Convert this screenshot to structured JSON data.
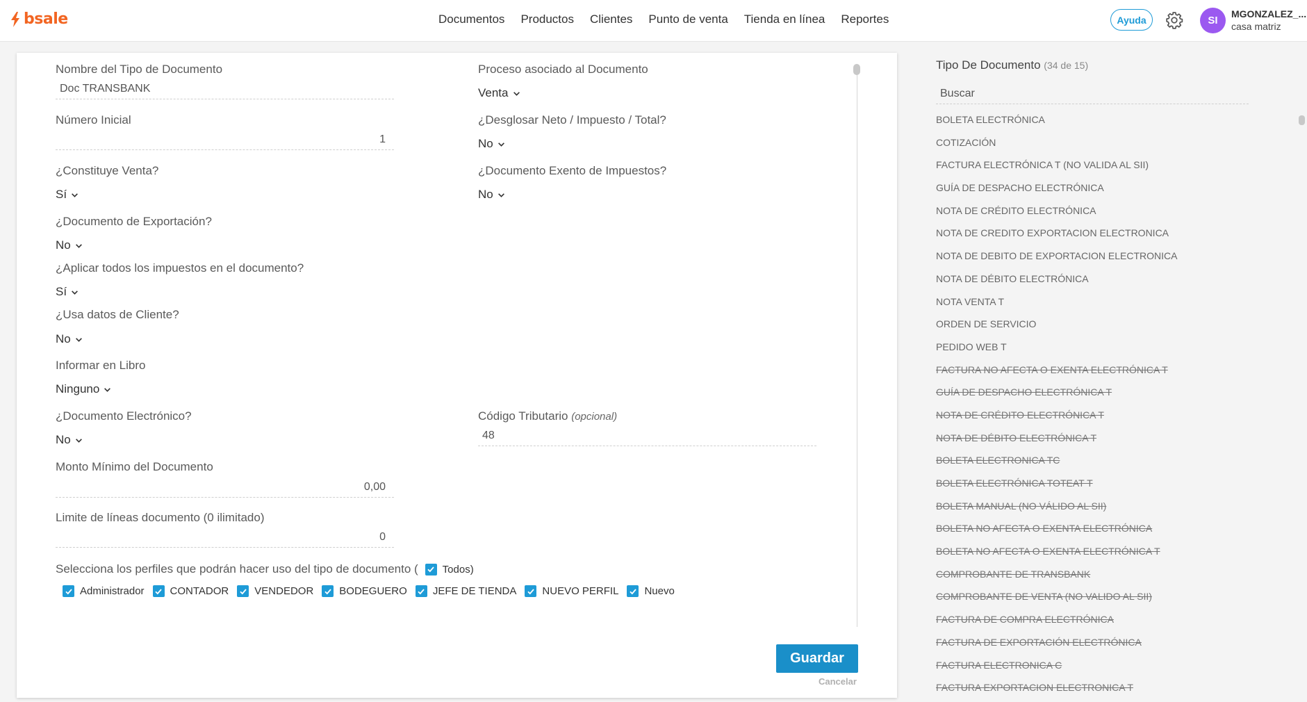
{
  "brand": {
    "name": "bsale",
    "color": "#f26522"
  },
  "nav": [
    "Documentos",
    "Productos",
    "Clientes",
    "Punto de venta",
    "Tienda en línea",
    "Reportes"
  ],
  "header": {
    "help_label": "Ayuda",
    "avatar_initials": "SI",
    "user_name": "MGONZALEZ_...",
    "branch": "casa matriz"
  },
  "form": {
    "nombre_label": "Nombre del Tipo de Documento",
    "nombre_value": "Doc TRANSBANK",
    "proceso_label": "Proceso asociado al Documento",
    "proceso_value": "Venta",
    "numero_label": "Número Inicial",
    "numero_value": "1",
    "desglosar_label": "¿Desglosar Neto / Impuesto / Total?",
    "desglosar_value": "No",
    "constituye_label": "¿Constituye Venta?",
    "constituye_value": "Sí",
    "exento_label": "¿Documento Exento de Impuestos?",
    "exento_value": "No",
    "exportacion_label": "¿Documento de Exportación?",
    "exportacion_value": "No",
    "impuestos_label": "¿Aplicar todos los impuestos en el documento?",
    "impuestos_value": "Sí",
    "cliente_label": "¿Usa datos de Cliente?",
    "cliente_value": "No",
    "libro_label": "Informar en Libro",
    "libro_value": "Ninguno",
    "electronico_label": "¿Documento Electrónico?",
    "electronico_value": "No",
    "codigo_label": "Código Tributario",
    "codigo_optional": "(opcional)",
    "codigo_value": "48",
    "monto_label": "Monto Mínimo del Documento",
    "monto_value": "0,00",
    "limite_label": "Limite de líneas documento (0 ilimitado)",
    "limite_value": "0",
    "perfiles_label": "Selecciona los perfiles que podrán hacer uso del tipo de documento (",
    "todos_label": "Todos)",
    "perfiles": [
      "Administrador",
      "CONTADOR",
      "VENDEDOR",
      "BODEGUERO",
      "JEFE DE TIENDA",
      "NUEVO PERFIL",
      "Nuevo"
    ],
    "save_label": "Guardar",
    "cancel_label": "Cancelar"
  },
  "sidebar": {
    "title": "Tipo De Documento",
    "count": "(34 de 15)",
    "search_placeholder": "Buscar",
    "items": [
      {
        "label": "BOLETA ELECTRÓNICA",
        "active": true
      },
      {
        "label": "COTIZACIÓN",
        "active": true
      },
      {
        "label": "FACTURA ELECTRÓNICA T (NO VALIDA AL SII)",
        "active": true
      },
      {
        "label": "GUÍA DE DESPACHO ELECTRÓNICA",
        "active": true
      },
      {
        "label": "NOTA DE CRÉDITO ELECTRÓNICA",
        "active": true
      },
      {
        "label": "NOTA DE CREDITO EXPORTACION ELECTRONICA",
        "active": true
      },
      {
        "label": "NOTA DE DEBITO DE EXPORTACION ELECTRONICA",
        "active": true
      },
      {
        "label": "NOTA DE DÉBITO ELECTRÓNICA",
        "active": true
      },
      {
        "label": "NOTA VENTA T",
        "active": true
      },
      {
        "label": "ORDEN DE SERVICIO",
        "active": true
      },
      {
        "label": "PEDIDO WEB T",
        "active": true
      },
      {
        "label": "FACTURA NO AFECTA O EXENTA ELECTRÓNICA T",
        "active": false
      },
      {
        "label": "GUÍA DE DESPACHO ELECTRÓNICA T",
        "active": false
      },
      {
        "label": "NOTA DE CRÉDITO ELECTRÓNICA T",
        "active": false
      },
      {
        "label": "NOTA DE DÉBITO ELECTRÓNICA T",
        "active": false
      },
      {
        "label": "BOLETA ELECTRONICA TC",
        "active": false
      },
      {
        "label": "BOLETA ELECTRÓNICA TOTEAT T",
        "active": false
      },
      {
        "label": "BOLETA MANUAL (NO VÁLIDO AL SII)",
        "active": false
      },
      {
        "label": "BOLETA NO AFECTA O EXENTA ELECTRÓNICA",
        "active": false
      },
      {
        "label": "BOLETA NO AFECTA O EXENTA ELECTRÓNICA T",
        "active": false
      },
      {
        "label": "COMPROBANTE DE TRANSBANK",
        "active": false
      },
      {
        "label": "COMPROBANTE DE VENTA (NO VALIDO AL SII)",
        "active": false
      },
      {
        "label": "FACTURA DE COMPRA ELECTRÓNICA",
        "active": false
      },
      {
        "label": "FACTURA DE EXPORTACIÓN ELECTRÓNICA",
        "active": false
      },
      {
        "label": "FACTURA ELECTRONICA C",
        "active": false
      },
      {
        "label": "FACTURA EXPORTACION ELECTRONICA T",
        "active": false
      }
    ]
  },
  "colors": {
    "accent": "#1e9bd7",
    "save_button": "#1a8fc9",
    "avatar": "#9b59f0"
  }
}
